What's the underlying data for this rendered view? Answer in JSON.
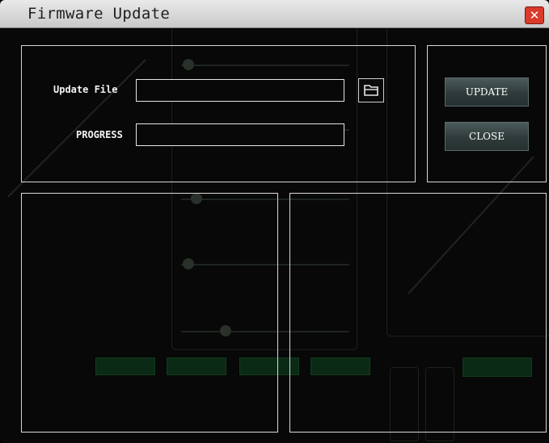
{
  "window": {
    "title": "Firmware Update",
    "close_icon": "close-icon"
  },
  "file_row": {
    "label": "Update File",
    "value": "",
    "browse_icon": "folder-open-icon"
  },
  "progress_row": {
    "label": "PROGRESS",
    "percent": 0
  },
  "buttons": {
    "update_label": "UPDATE",
    "close_label": "CLOSE"
  },
  "colors": {
    "close_button": "#d93a2a",
    "button_bg": "#3a4747",
    "panel_border": "#d8d8d8"
  }
}
